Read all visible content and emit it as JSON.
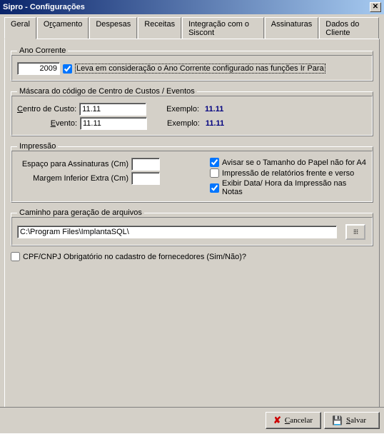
{
  "window": {
    "title": "Sipro - Configurações"
  },
  "tabs": {
    "items": [
      {
        "label": "Geral"
      },
      {
        "label": "Orçamento"
      },
      {
        "label": "Despesas"
      },
      {
        "label": "Receitas"
      },
      {
        "label": "Integração com o Siscont"
      },
      {
        "label": "Assinaturas"
      },
      {
        "label": "Dados do Cliente"
      }
    ]
  },
  "ano": {
    "legend": "Ano Corrente",
    "value": "2009",
    "chk_label": "Leva em consideração o Ano Corrente configurado nas funções Ir Para",
    "chk_checked": true
  },
  "mask": {
    "legend": "Máscara do código de Centro de Custos / Eventos",
    "centro_label": "Centro de Custo:",
    "centro_value": "11.11",
    "evento_label": "Evento:",
    "evento_value": "11.11",
    "example_label": "Exemplo:",
    "example_value1": "11.11",
    "example_value2": "11.11",
    "centro_underline": "C",
    "evento_underline": "E"
  },
  "impress": {
    "legend": "Impressão",
    "espaco_label": "Espaço para Assinaturas (Cm)",
    "espaco_value": "",
    "margem_label": "Margem Inferior Extra (Cm)",
    "margem_value": "",
    "chk_a4_label": "Avisar se o Tamanho do Papel não for A4",
    "chk_a4_checked": true,
    "chk_frente_label": "Impressão de relatórios frente e verso",
    "chk_frente_checked": false,
    "chk_data_label": "Exibir Data/ Hora da Impressão nas Notas",
    "chk_data_checked": true
  },
  "path": {
    "legend": "Caminho para geração de arquivos",
    "value": "C:\\Program Files\\ImplantaSQL\\",
    "browse_icon": "⁞⁞"
  },
  "cpf": {
    "label": "CPF/CNPJ Obrigatório no cadastro de fornecedores (Sim/Não)?",
    "checked": false
  },
  "buttons": {
    "cancel_u": "C",
    "cancel_rest": "ancelar",
    "save_u": "S",
    "save_rest": "alvar"
  }
}
